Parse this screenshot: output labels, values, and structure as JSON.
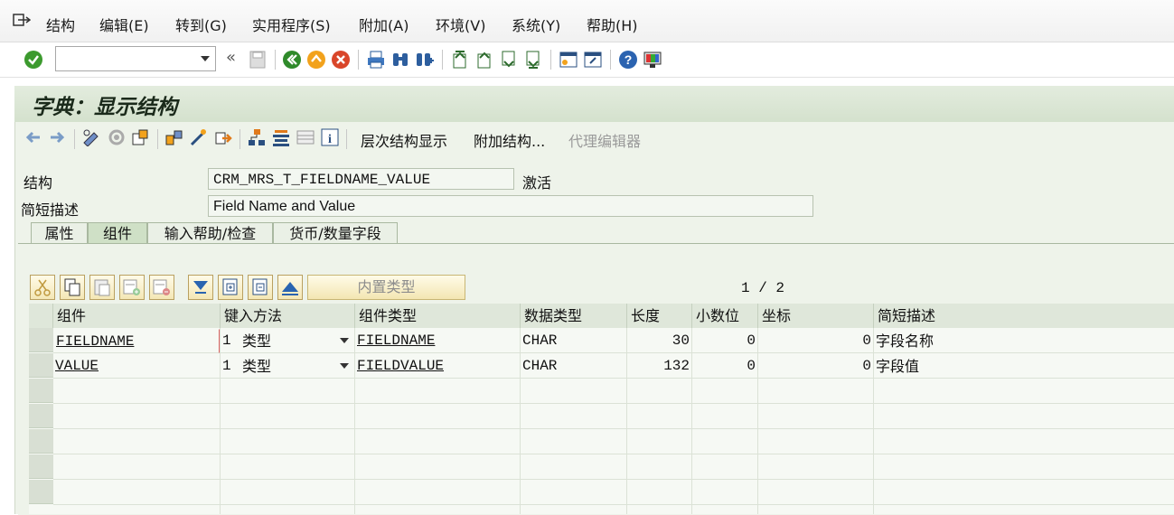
{
  "menu": [
    "结构",
    "编辑(E)",
    "转到(G)",
    "实用程序(S)",
    "附加(A)",
    "环境(V)",
    "系统(Y)",
    "帮助(H)"
  ],
  "std_toolbar": {
    "command_value": "",
    "collapse_glyph": "«"
  },
  "title": "字典：显示结构",
  "app_toolbar": {
    "hierarchy": "层次结构显示",
    "append": "附加结构...",
    "proxy_editor": "代理编辑器"
  },
  "structure": {
    "label": "结构",
    "value": "CRM_MRS_T_FIELDNAME_VALUE",
    "status": "激活"
  },
  "short_desc": {
    "label": "简短描述",
    "value": "Field Name and Value"
  },
  "tabs": [
    "属性",
    "组件",
    "输入帮助/检查",
    "货币/数量字段"
  ],
  "table_toolbar": {
    "builtin_type": "内置类型"
  },
  "pager": "1 / 2",
  "columns": [
    "组件",
    "键入方法",
    "组件类型",
    "数据类型",
    "长度",
    "小数位",
    "坐标",
    "简短描述"
  ],
  "rows": [
    {
      "component": "FIELDNAME",
      "typing_num": "1",
      "typing": "类型",
      "comp_type": "FIELDNAME",
      "data_type": "CHAR",
      "length": "30",
      "decimals": "0",
      "coord": "0",
      "desc": "字段名称"
    },
    {
      "component": "VALUE",
      "typing_num": "1",
      "typing": "类型",
      "comp_type": "FIELDVALUE",
      "data_type": "CHAR",
      "length": "132",
      "decimals": "0",
      "coord": "0",
      "desc": "字段值"
    }
  ]
}
